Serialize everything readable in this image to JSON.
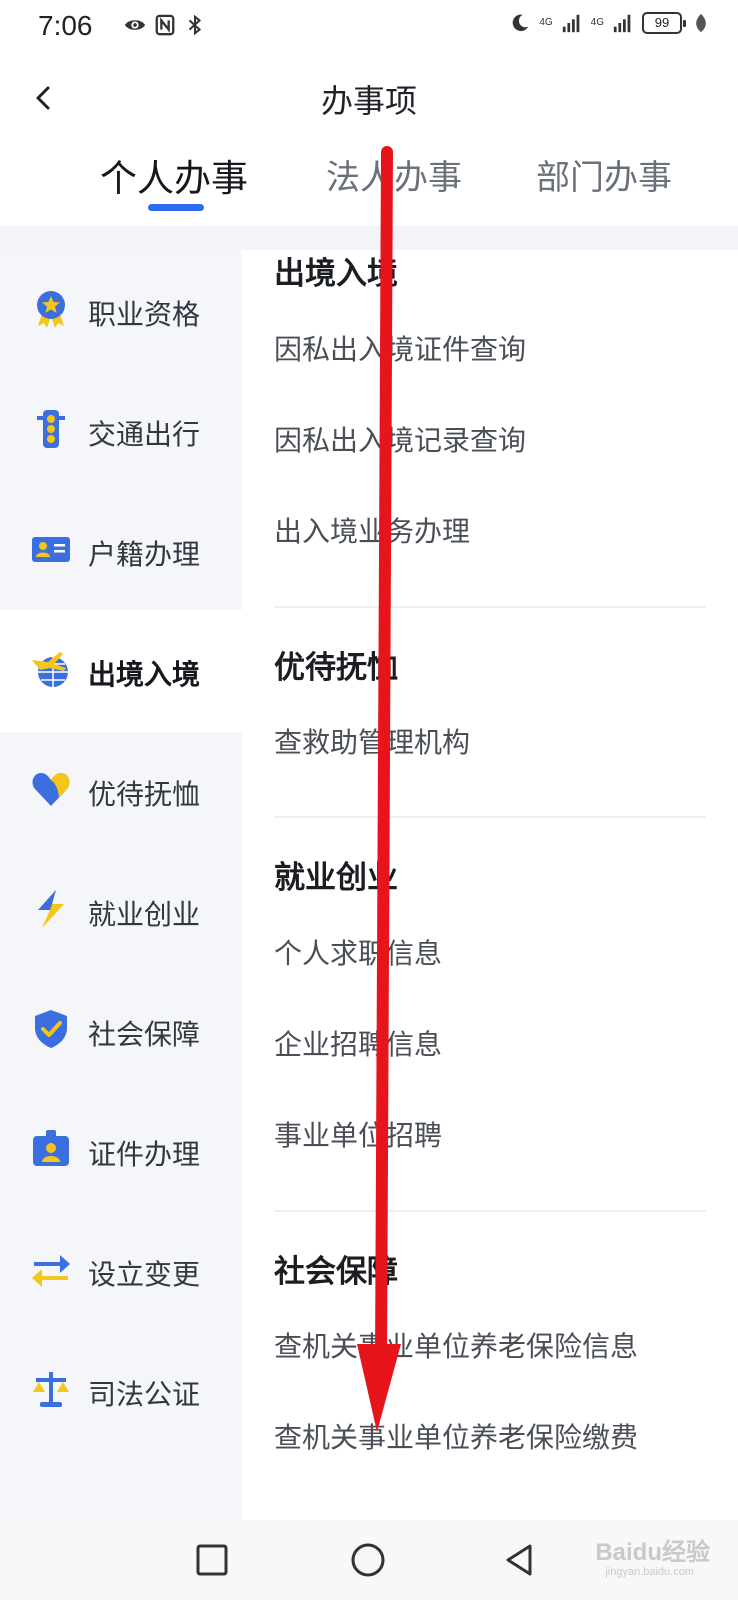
{
  "status_bar": {
    "time": "7:06",
    "battery": "99",
    "signal1": "4G",
    "signal2": "4G"
  },
  "nav": {
    "title": "办事项",
    "back_icon": "chevron-left-icon"
  },
  "tabs": [
    {
      "label": "个人办事",
      "active": true
    },
    {
      "label": "法人办事",
      "active": false
    },
    {
      "label": "部门办事",
      "active": false
    }
  ],
  "sidebar": {
    "items": [
      {
        "label": "职业资格",
        "icon": "medal-icon"
      },
      {
        "label": "交通出行",
        "icon": "traffic-light-icon"
      },
      {
        "label": "户籍办理",
        "icon": "id-card-icon"
      },
      {
        "label": "出境入境",
        "icon": "plane-globe-icon",
        "active": true
      },
      {
        "label": "优待抚恤",
        "icon": "heart-icon"
      },
      {
        "label": "就业创业",
        "icon": "lightning-icon"
      },
      {
        "label": "社会保障",
        "icon": "shield-check-icon"
      },
      {
        "label": "证件办理",
        "icon": "badge-icon"
      },
      {
        "label": "设立变更",
        "icon": "swap-arrows-icon"
      },
      {
        "label": "司法公证",
        "icon": "scales-icon"
      }
    ]
  },
  "content": {
    "sections": [
      {
        "title": "出境入境",
        "items": [
          "因私出入境证件查询",
          "因私出入境记录查询",
          "出入境业务办理"
        ]
      },
      {
        "title": "优待抚恤",
        "items": [
          "查救助管理机构"
        ]
      },
      {
        "title": "就业创业",
        "items": [
          "个人求职信息",
          "企业招聘信息",
          "事业单位招聘"
        ]
      },
      {
        "title": "社会保障",
        "items": [
          "查机关事业单位养老保险信息",
          "查机关事业单位养老保险缴费"
        ]
      }
    ]
  },
  "watermark": {
    "text": "Baidu经验",
    "sub": "jingyan.baidu.com"
  },
  "colors": {
    "accent": "#2f6bf0",
    "icon_blue": "#3b6fe0",
    "icon_yellow": "#f5c518",
    "overlay_arrow": "#e8141b"
  }
}
